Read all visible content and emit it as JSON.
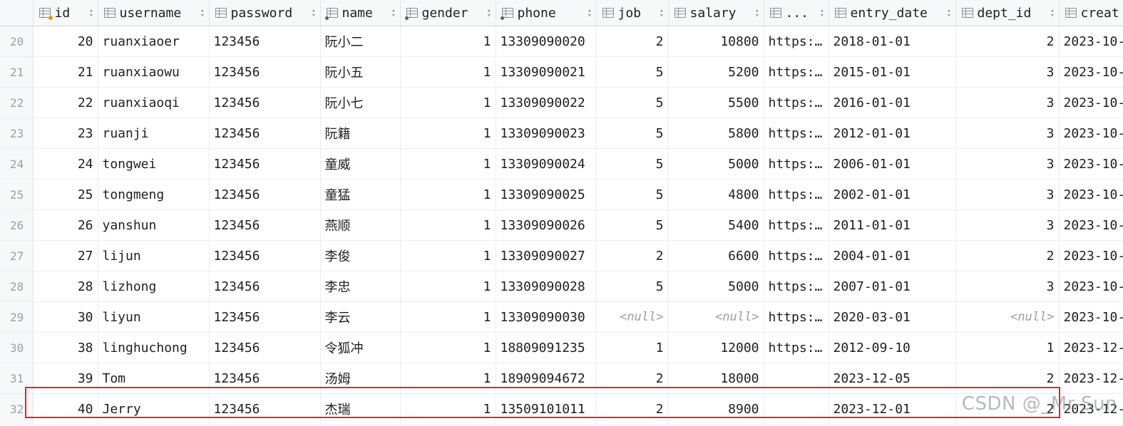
{
  "columns": [
    {
      "key": "id",
      "label": "id",
      "icon": "primary-key-column-icon",
      "align": "right"
    },
    {
      "key": "username",
      "label": "username",
      "icon": "table-column-icon",
      "align": "left"
    },
    {
      "key": "password",
      "label": "password",
      "icon": "table-column-icon",
      "align": "left"
    },
    {
      "key": "name",
      "label": "name",
      "icon": "indexed-column-icon",
      "align": "left"
    },
    {
      "key": "gender",
      "label": "gender",
      "icon": "indexed-column-icon",
      "align": "right"
    },
    {
      "key": "phone",
      "label": "phone",
      "icon": "indexed-column-icon",
      "align": "left"
    },
    {
      "key": "job",
      "label": "job",
      "icon": "table-column-icon",
      "align": "right"
    },
    {
      "key": "salary",
      "label": "salary",
      "icon": "table-column-icon",
      "align": "right"
    },
    {
      "key": "image",
      "label": "...",
      "icon": "table-column-icon",
      "align": "left"
    },
    {
      "key": "entry_date",
      "label": "entry_date",
      "icon": "table-column-icon",
      "align": "left"
    },
    {
      "key": "dept_id",
      "label": "dept_id",
      "icon": "table-column-icon",
      "align": "right"
    },
    {
      "key": "create_time",
      "label": "creat",
      "icon": "table-column-icon",
      "align": "left"
    }
  ],
  "null_label": "<null>",
  "rows": [
    {
      "rownum": "20",
      "id": "20",
      "username": "ruanxiaoer",
      "password": "123456",
      "name": "阮小二",
      "gender": "1",
      "phone": "13309090020",
      "job": "2",
      "salary": "10800",
      "image": "https:…",
      "entry_date": "2018-01-01",
      "dept_id": "2",
      "create_time": "2023-10-"
    },
    {
      "rownum": "21",
      "id": "21",
      "username": "ruanxiaowu",
      "password": "123456",
      "name": "阮小五",
      "gender": "1",
      "phone": "13309090021",
      "job": "5",
      "salary": "5200",
      "image": "https:…",
      "entry_date": "2015-01-01",
      "dept_id": "3",
      "create_time": "2023-10-"
    },
    {
      "rownum": "22",
      "id": "22",
      "username": "ruanxiaoqi",
      "password": "123456",
      "name": "阮小七",
      "gender": "1",
      "phone": "13309090022",
      "job": "5",
      "salary": "5500",
      "image": "https:…",
      "entry_date": "2016-01-01",
      "dept_id": "3",
      "create_time": "2023-10-"
    },
    {
      "rownum": "23",
      "id": "23",
      "username": "ruanji",
      "password": "123456",
      "name": "阮籍",
      "gender": "1",
      "phone": "13309090023",
      "job": "5",
      "salary": "5800",
      "image": "https:…",
      "entry_date": "2012-01-01",
      "dept_id": "3",
      "create_time": "2023-10-"
    },
    {
      "rownum": "24",
      "id": "24",
      "username": "tongwei",
      "password": "123456",
      "name": "童威",
      "gender": "1",
      "phone": "13309090024",
      "job": "5",
      "salary": "5000",
      "image": "https:…",
      "entry_date": "2006-01-01",
      "dept_id": "3",
      "create_time": "2023-10-"
    },
    {
      "rownum": "25",
      "id": "25",
      "username": "tongmeng",
      "password": "123456",
      "name": "童猛",
      "gender": "1",
      "phone": "13309090025",
      "job": "5",
      "salary": "4800",
      "image": "https:…",
      "entry_date": "2002-01-01",
      "dept_id": "3",
      "create_time": "2023-10-"
    },
    {
      "rownum": "26",
      "id": "26",
      "username": "yanshun",
      "password": "123456",
      "name": "燕顺",
      "gender": "1",
      "phone": "13309090026",
      "job": "5",
      "salary": "5400",
      "image": "https:…",
      "entry_date": "2011-01-01",
      "dept_id": "3",
      "create_time": "2023-10-"
    },
    {
      "rownum": "27",
      "id": "27",
      "username": "lijun",
      "password": "123456",
      "name": "李俊",
      "gender": "1",
      "phone": "13309090027",
      "job": "2",
      "salary": "6600",
      "image": "https:…",
      "entry_date": "2004-01-01",
      "dept_id": "2",
      "create_time": "2023-10-"
    },
    {
      "rownum": "28",
      "id": "28",
      "username": "lizhong",
      "password": "123456",
      "name": "李忠",
      "gender": "1",
      "phone": "13309090028",
      "job": "5",
      "salary": "5000",
      "image": "https:…",
      "entry_date": "2007-01-01",
      "dept_id": "3",
      "create_time": "2023-10-"
    },
    {
      "rownum": "29",
      "id": "30",
      "username": "liyun",
      "password": "123456",
      "name": "李云",
      "gender": "1",
      "phone": "13309090030",
      "job": null,
      "salary": null,
      "image": "https:…",
      "entry_date": "2020-03-01",
      "dept_id": null,
      "create_time": "2023-10-"
    },
    {
      "rownum": "30",
      "id": "38",
      "username": "linghuchong",
      "password": "123456",
      "name": "令狐冲",
      "gender": "1",
      "phone": "18809091235",
      "job": "1",
      "salary": "12000",
      "image": "https:…",
      "entry_date": "2012-09-10",
      "dept_id": "1",
      "create_time": "2023-12-"
    },
    {
      "rownum": "31",
      "id": "39",
      "username": "Tom",
      "password": "123456",
      "name": "汤姆",
      "gender": "1",
      "phone": "18909094672",
      "job": "2",
      "salary": "18000",
      "image": "",
      "entry_date": "2023-12-05",
      "dept_id": "2",
      "create_time": "2023-12-"
    },
    {
      "rownum": "32",
      "id": "40",
      "username": "Jerry",
      "password": "123456",
      "name": "杰瑞",
      "gender": "1",
      "phone": "13509101011",
      "job": "2",
      "salary": "8900",
      "image": "",
      "entry_date": "2023-12-01",
      "dept_id": "2",
      "create_time": "2023-12-"
    }
  ],
  "highlighted_row": "32",
  "watermark": "CSDN @_Mr-Sun",
  "colors": {
    "highlight_border": "#e0262b",
    "header_bg": "#f7f8fa",
    "null_text": "#9aa0a8"
  }
}
